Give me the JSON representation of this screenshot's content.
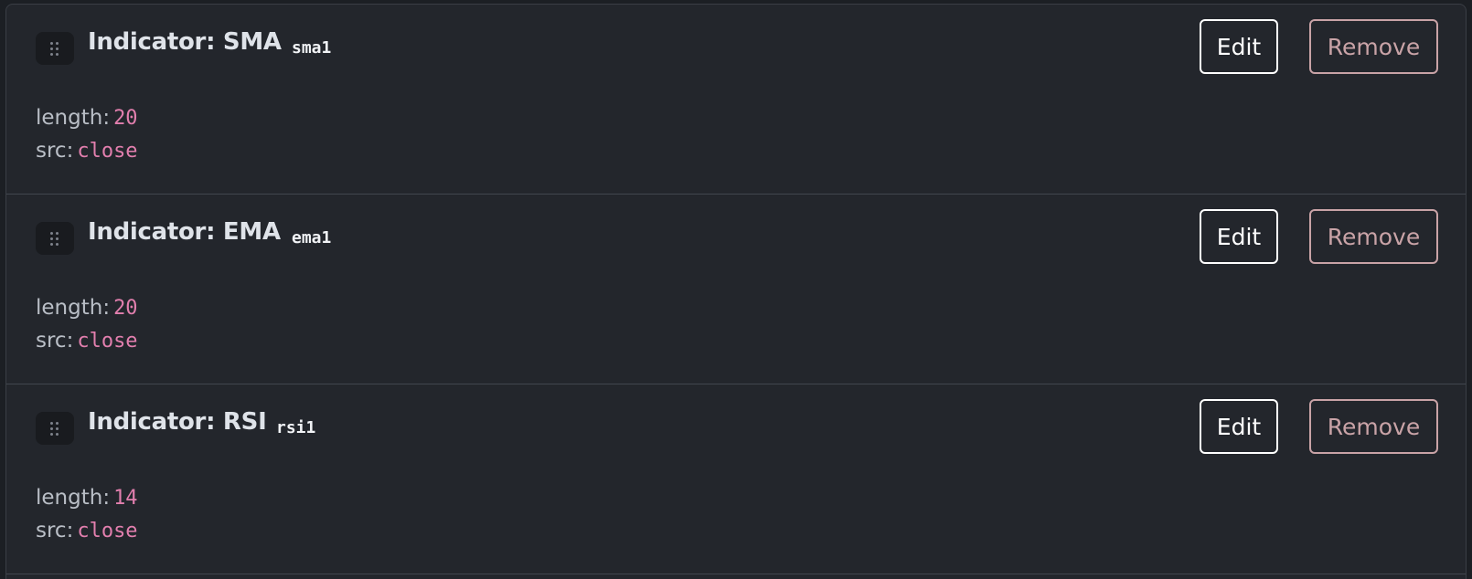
{
  "indicators": [
    {
      "title": "Indicator: SMA",
      "id": "sma1",
      "edit_label": "Edit",
      "remove_label": "Remove",
      "params": [
        {
          "key": "length:",
          "value": "20"
        },
        {
          "key": "src:",
          "value": "close"
        }
      ]
    },
    {
      "title": "Indicator: EMA",
      "id": "ema1",
      "edit_label": "Edit",
      "remove_label": "Remove",
      "params": [
        {
          "key": "length:",
          "value": "20"
        },
        {
          "key": "src:",
          "value": "close"
        }
      ]
    },
    {
      "title": "Indicator: RSI",
      "id": "rsi1",
      "edit_label": "Edit",
      "remove_label": "Remove",
      "params": [
        {
          "key": "length:",
          "value": "14"
        },
        {
          "key": "src:",
          "value": "close"
        }
      ]
    }
  ],
  "icons": {
    "drag_handle": "drag-handle-icon"
  },
  "colors": {
    "panel_bg": "#23262c",
    "param_value": "#e27fae",
    "remove_border": "#c9a3a7",
    "edit_border": "#ffffff"
  }
}
